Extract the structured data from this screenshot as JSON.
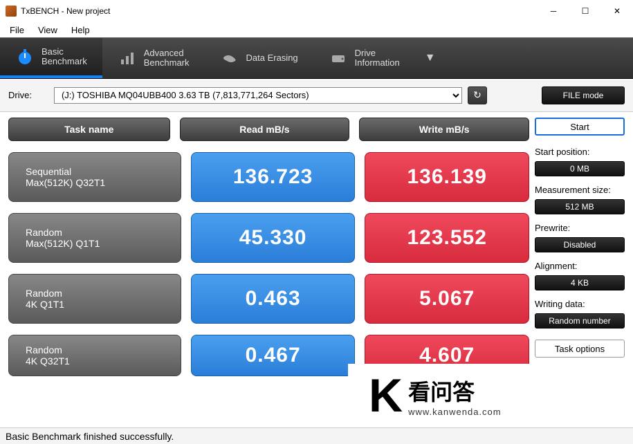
{
  "window": {
    "title": "TxBENCH - New project"
  },
  "menu": [
    "File",
    "View",
    "Help"
  ],
  "tabs": [
    {
      "line1": "Basic",
      "line2": "Benchmark",
      "active": true
    },
    {
      "line1": "Advanced",
      "line2": "Benchmark",
      "active": false
    },
    {
      "line1": "Data Erasing",
      "line2": "",
      "active": false
    },
    {
      "line1": "Drive",
      "line2": "Information",
      "active": false
    }
  ],
  "drive": {
    "label": "Drive:",
    "selected": "(J:) TOSHIBA MQ04UBB400  3.63 TB (7,813,771,264 Sectors)",
    "mode": "FILE mode"
  },
  "headers": {
    "task": "Task name",
    "read": "Read mB/s",
    "write": "Write mB/s"
  },
  "rows": [
    {
      "name1": "Sequential",
      "name2": "Max(512K) Q32T1",
      "read": "136.723",
      "write": "136.139"
    },
    {
      "name1": "Random",
      "name2": "Max(512K) Q1T1",
      "read": "45.330",
      "write": "123.552"
    },
    {
      "name1": "Random",
      "name2": "4K Q1T1",
      "read": "0.463",
      "write": "5.067"
    },
    {
      "name1": "Random",
      "name2": "4K Q32T1",
      "read": "0.467",
      "write": "4.607"
    }
  ],
  "side": {
    "start": "Start",
    "params": [
      {
        "label": "Start position:",
        "value": "0 MB"
      },
      {
        "label": "Measurement size:",
        "value": "512 MB"
      },
      {
        "label": "Prewrite:",
        "value": "Disabled"
      },
      {
        "label": "Alignment:",
        "value": "4 KB"
      },
      {
        "label": "Writing data:",
        "value": "Random number"
      }
    ],
    "task_options": "Task options"
  },
  "status": "Basic Benchmark finished successfully.",
  "watermark": {
    "main": "看问答",
    "sub": "www.kanwenda.com"
  }
}
